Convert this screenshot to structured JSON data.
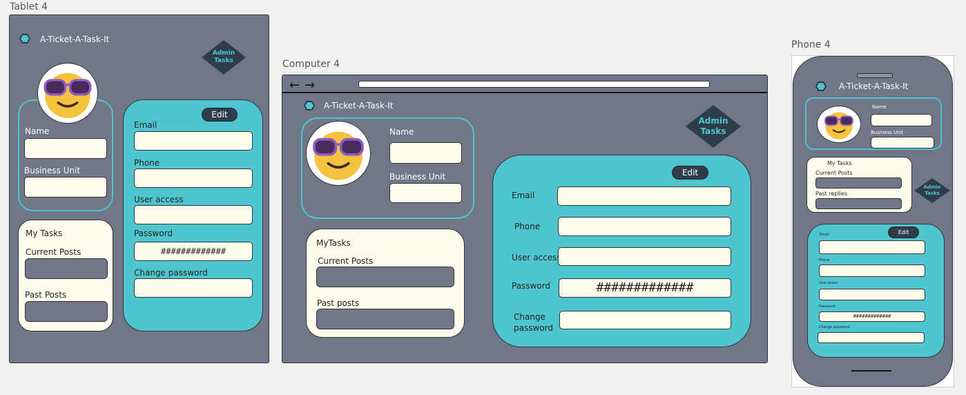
{
  "frames": {
    "tablet": "Tablet 4",
    "computer": "Computer 4",
    "phone": "Phone 4"
  },
  "app": {
    "brand": "A-Ticket-A-Task-It",
    "admin": "Admin\nTasks"
  },
  "colors": {
    "frame": "#6f7789",
    "teal": "#4fc6cf",
    "cream": "#fffdee",
    "dark": "#2f3d4a"
  },
  "icons": {
    "logo": "hexagon-logo-icon",
    "avatar": "sunglasses-emoji-avatar",
    "back": "arrow-left-icon",
    "forward": "arrow-right-icon"
  },
  "tablet": {
    "profile": {
      "name": "Name",
      "business_unit": "Business Unit"
    },
    "tasks": {
      "title": "My Tasks",
      "current": "Current Posts",
      "past": "Past Posts"
    },
    "details": {
      "edit": "Edit",
      "email": "Email",
      "phone": "Phone",
      "user_access": "User access",
      "password": "Password",
      "password_value": "#############",
      "change_password": "Change password"
    }
  },
  "computer": {
    "profile": {
      "name": "Name",
      "business_unit": "Business Unit"
    },
    "tasks": {
      "title": "MyTasks",
      "current": "Current Posts",
      "past": "Past posts"
    },
    "details": {
      "edit": "Edit",
      "email": "Email",
      "phone": "Phone",
      "user_access": "User access",
      "password": "Password",
      "password_value": "#############",
      "change_password": "Change\npassword"
    }
  },
  "phone": {
    "profile": {
      "name": "Name",
      "business_unit": "Business Unit"
    },
    "tasks": {
      "title": "My Tasks",
      "current": "Current Posts",
      "past": "Past replies"
    },
    "details": {
      "edit": "Edit",
      "email": "Email",
      "phone": "Phone",
      "user_access": "User acess",
      "password": "Password",
      "password_value": "#############",
      "change_password": "Change password"
    }
  }
}
